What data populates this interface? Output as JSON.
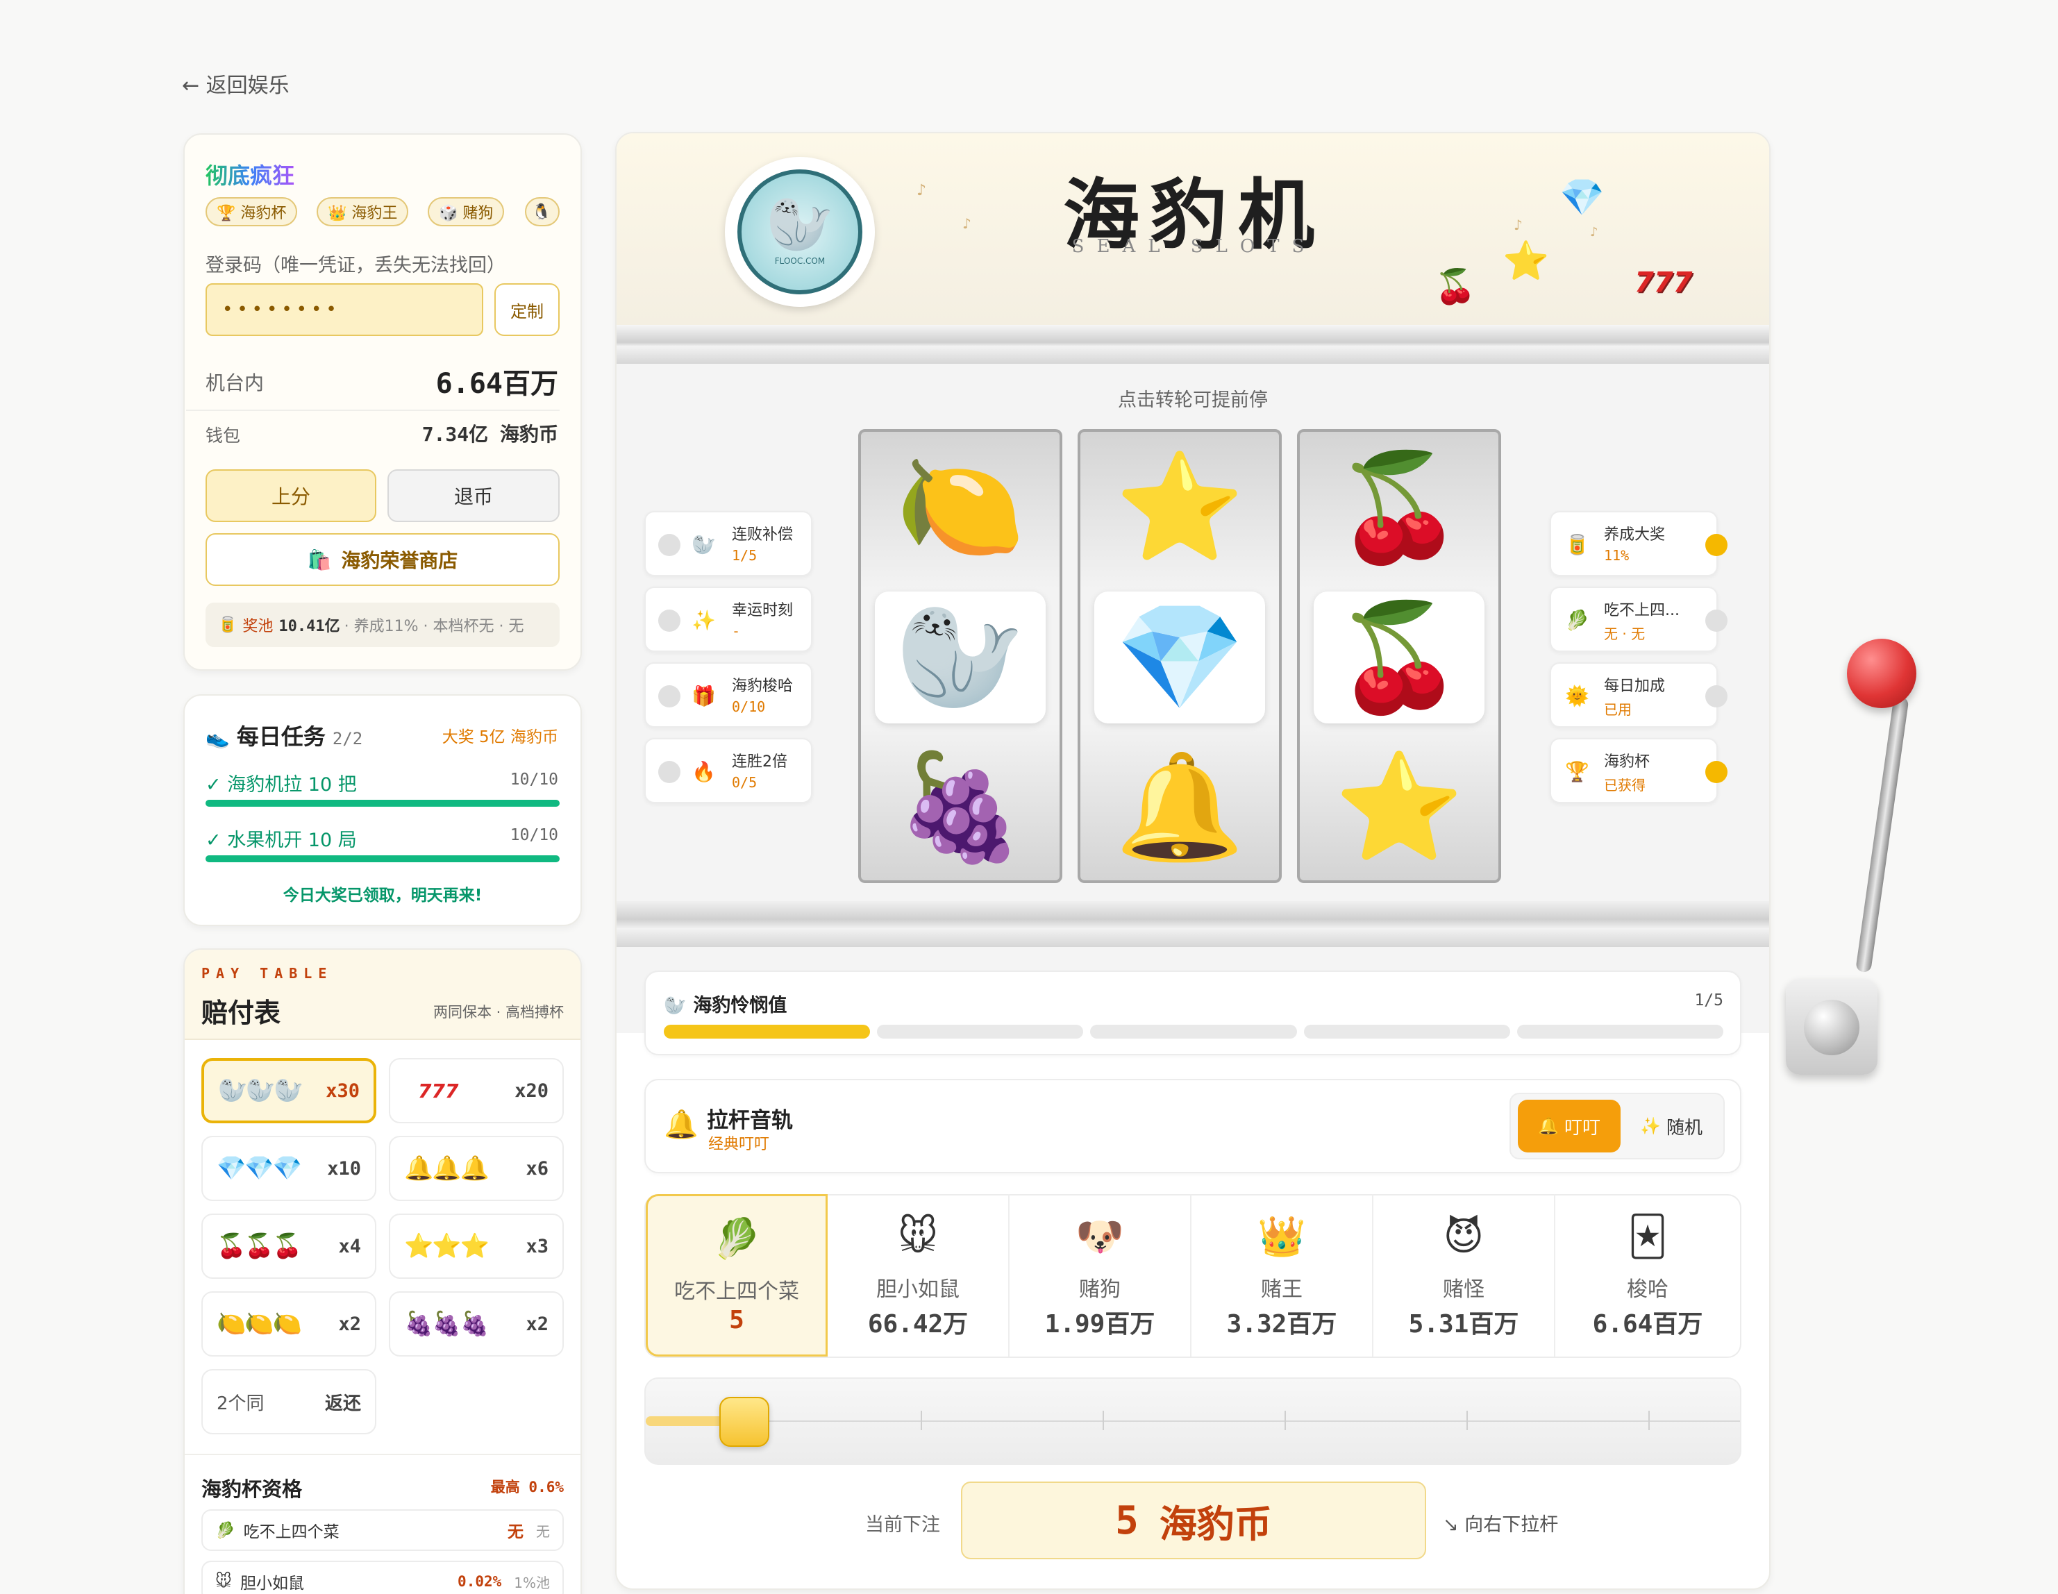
{
  "nav": {
    "back_label": "← 返回娱乐"
  },
  "account": {
    "title": "彻底疯狂",
    "badges": [
      "🏆 海豹杯",
      "👑 海豹王",
      "🎲 赌狗",
      "🐧"
    ],
    "login_label": "登录码（唯一凭证，丢失无法找回）",
    "login_value": "••••••••",
    "customize_label": "定制",
    "machine_label": "机台内",
    "machine_value": "6.64百万",
    "wallet_label": "钱包",
    "wallet_value": "7.34亿 海豹币",
    "deposit_label": "上分",
    "withdraw_label": "退币",
    "shop_label": "海豹荣誉商店",
    "pool_label": "奖池",
    "pool_value": "10.41亿",
    "pool_info": "· 养成11% · 本档杯无 · 无"
  },
  "tasks": {
    "title": "每日任务",
    "count": "2/2",
    "reward": "大奖 5亿 海豹币",
    "items": [
      {
        "label": "✓ 海豹机拉 10 把",
        "progress": "10/10",
        "fill": 1.0
      },
      {
        "label": "✓ 水果机开 10 局",
        "progress": "10/10",
        "fill": 1.0
      }
    ],
    "footer": "今日大奖已领取，明天再来!"
  },
  "paytable": {
    "eyebrow": "PAY TABLE",
    "title": "赔付表",
    "note": "两同保本 · 高档搏杯",
    "rows": [
      {
        "icons": "🦭🦭🦭",
        "mult": "x30"
      },
      {
        "icons": "777",
        "mult": "x20"
      },
      {
        "icons": "💎💎💎",
        "mult": "x10"
      },
      {
        "icons": "🔔🔔🔔",
        "mult": "x6"
      },
      {
        "icons": "🍒🍒🍒",
        "mult": "x4"
      },
      {
        "icons": "⭐⭐⭐",
        "mult": "x3"
      },
      {
        "icons": "🍋🍋🍋",
        "mult": "x2"
      },
      {
        "icons": "🍇🍇🍇",
        "mult": "x2"
      }
    ],
    "two_same_label": "2个同",
    "two_same_value": "返还"
  },
  "eligibility": {
    "title": "海豹杯资格",
    "max": "最高 0.6%",
    "rows": [
      {
        "icon": "🥬",
        "name": "吃不上四个菜",
        "value": "无",
        "pool": "无"
      },
      {
        "icon": "🐭",
        "name": "胆小如鼠",
        "value": "0.02%",
        "pool": "1%池"
      }
    ]
  },
  "machine": {
    "title": "海豹机",
    "subtitle": "SEAL SLOTS",
    "logo_text": "FLOOC.COM",
    "hint": "点击转轮可提前停",
    "reels": [
      [
        "🍋",
        "🦭",
        "🍇"
      ],
      [
        "⭐",
        "💎",
        "🔔"
      ],
      [
        "🍒",
        "🍒",
        "⭐"
      ]
    ],
    "left_status": [
      {
        "icon": "🦭",
        "name": "连败补偿",
        "value": "1/5"
      },
      {
        "icon": "✨",
        "name": "幸运时刻",
        "value": "-"
      },
      {
        "icon": "🎁",
        "name": "海豹梭哈",
        "value": "0/10"
      },
      {
        "icon": "🔥",
        "name": "连胜2倍",
        "value": "0/5"
      }
    ],
    "right_status": [
      {
        "icon": "🥫",
        "name": "养成大奖",
        "value": "11%",
        "active": true
      },
      {
        "icon": "🥬",
        "name": "吃不上四...",
        "value": "无 · 无",
        "active": false
      },
      {
        "icon": "🌞",
        "name": "每日加成",
        "value": "已用",
        "active": false
      },
      {
        "icon": "🏆",
        "name": "海豹杯",
        "value": "已获得",
        "active": true
      }
    ]
  },
  "pity": {
    "label": "海豹怜悯值",
    "value": "1/5",
    "filled": 1,
    "segments": 5
  },
  "sound": {
    "title": "拉杆音轨",
    "subtitle": "经典叮叮",
    "option_a": "叮叮",
    "option_b": "随机"
  },
  "bets": [
    {
      "emoji": "🥬",
      "name": "吃不上四个菜",
      "value": "5",
      "selected": true
    },
    {
      "emoji": "🐭",
      "name": "胆小如鼠",
      "value": "66.42万"
    },
    {
      "emoji": "🐶",
      "name": "赌狗",
      "value": "1.99百万"
    },
    {
      "emoji": "👑",
      "name": "赌王",
      "value": "3.32百万"
    },
    {
      "emoji": "😈",
      "name": "赌怪",
      "value": "5.31百万"
    },
    {
      "emoji": "🃏",
      "name": "梭哈",
      "value": "6.64百万"
    }
  ],
  "slider": {
    "level": 0
  },
  "current_bet": {
    "label": "当前下注",
    "amount": "5",
    "unit": "海豹币",
    "hint": "↘ 向右下拉杆"
  },
  "colors": {
    "accent": "#f59e0b",
    "green": "#10b981",
    "orange": "#e07a00",
    "cream": "#fdf6dc"
  }
}
